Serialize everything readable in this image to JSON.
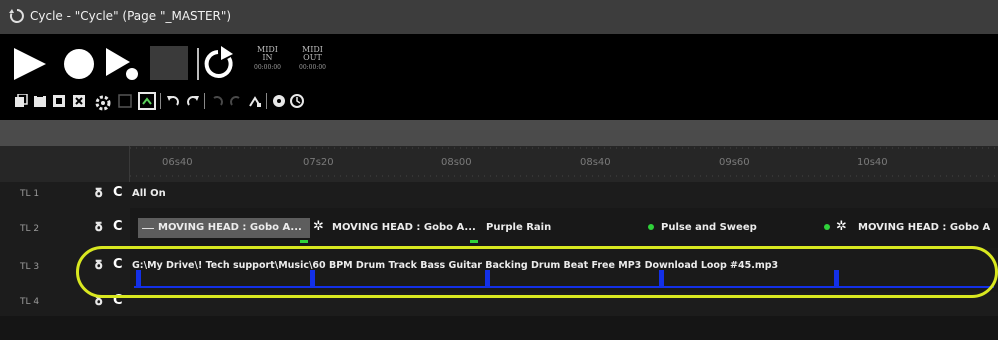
{
  "window": {
    "title": "Cycle - \"Cycle\" (Page \"_MASTER\")",
    "title_icon": "cycle-icon"
  },
  "transport": {
    "buttons": [
      "play-icon",
      "record-icon",
      "step-play-icon",
      "stop-icon",
      "loop-icon"
    ],
    "midi_in": {
      "line1": "MIDI",
      "line2": "IN",
      "counter": "00:00:00"
    },
    "midi_out": {
      "line1": "MIDI",
      "line2": "OUT",
      "counter": "00:00:00"
    }
  },
  "toolbar": {
    "icons": [
      "copy-icon",
      "paste-icon",
      "duplicate-icon",
      "delete-icon",
      "settings-icon",
      "save-icon",
      "export-icon",
      "undo-icon",
      "redo-icon",
      "loop-back-icon",
      "loop-forward-icon",
      "jump-icon",
      "record-marker-icon",
      "clock-icon"
    ]
  },
  "ruler": {
    "labels": [
      "06s40",
      "07s20",
      "08s00",
      "08s40",
      "09s60",
      "10s40"
    ]
  },
  "tracks": [
    {
      "id": "TL 1",
      "clips": [
        {
          "label": "All On"
        }
      ]
    },
    {
      "id": "TL 2",
      "clips": [
        {
          "label": "MOVING HEAD : Gobo A..."
        },
        {
          "label": "MOVING HEAD : Gobo A..."
        },
        {
          "label": "Purple Rain"
        },
        {
          "label": "Pulse and Sweep"
        },
        {
          "label": "MOVING HEAD : Gobo A"
        }
      ]
    },
    {
      "id": "TL 3",
      "clips": [
        {
          "label": "G:\\My Drive\\! Tech support\\Music\\60 BPM Drum Track Bass Guitar Backing Drum Beat Free MP3 Download Loop #45.mp3"
        }
      ]
    },
    {
      "id": "TL 4",
      "clips": []
    }
  ],
  "colors": {
    "highlight": "#d9e820",
    "audio": "#1330e8",
    "cue_dot": "#2fd13a"
  }
}
